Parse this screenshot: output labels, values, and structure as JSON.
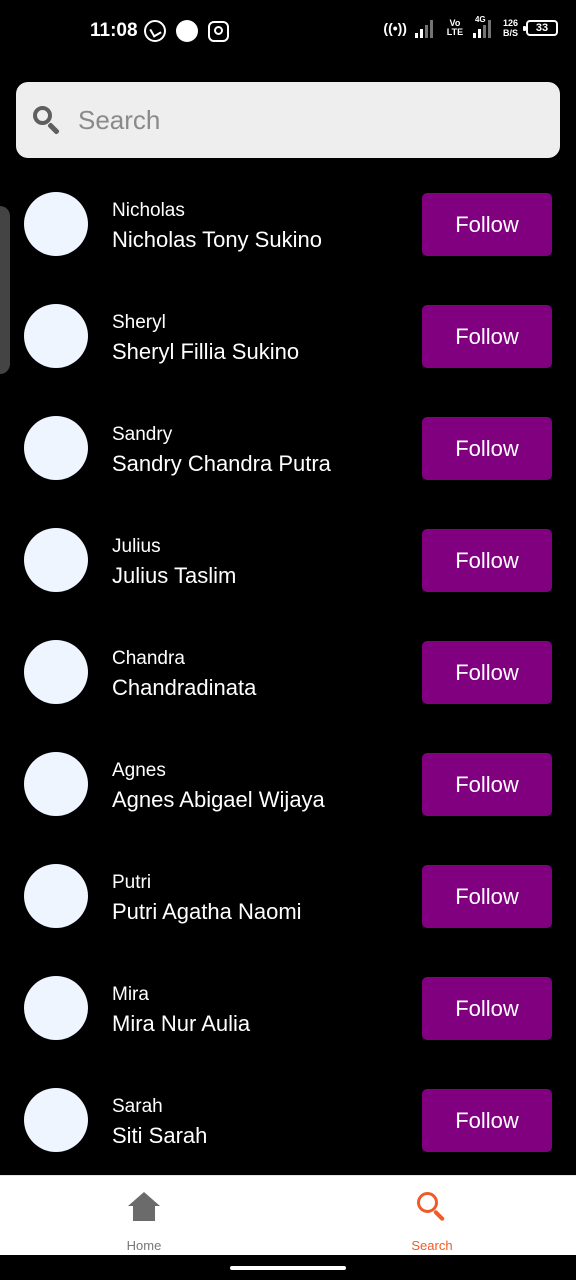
{
  "status_bar": {
    "time": "11:08",
    "hotspot": "((•))",
    "lte_top": "Vo",
    "lte_bottom": "LTE",
    "net_type": "4G",
    "speed_value": "126",
    "speed_unit": "B/S",
    "battery": "33"
  },
  "search": {
    "placeholder": "Search"
  },
  "users": [
    {
      "username": "Nicholas",
      "full_name": "Nicholas Tony Sukino",
      "button": "Follow"
    },
    {
      "username": "Sheryl",
      "full_name": "Sheryl Fillia Sukino",
      "button": "Follow"
    },
    {
      "username": "Sandry",
      "full_name": "Sandry Chandra Putra",
      "button": "Follow"
    },
    {
      "username": "Julius",
      "full_name": "Julius Taslim",
      "button": "Follow"
    },
    {
      "username": "Chandra",
      "full_name": "Chandradinata",
      "button": "Follow"
    },
    {
      "username": "Agnes",
      "full_name": "Agnes Abigael Wijaya",
      "button": "Follow"
    },
    {
      "username": "Putri",
      "full_name": "Putri Agatha Naomi",
      "button": "Follow"
    },
    {
      "username": "Mira",
      "full_name": "Mira Nur Aulia",
      "button": "Follow"
    },
    {
      "username": "Sarah",
      "full_name": "Siti Sarah",
      "button": "Follow"
    }
  ],
  "bottom_nav": {
    "home_label": "Home",
    "search_label": "Search",
    "active": "search"
  },
  "colors": {
    "follow_button": "#800080",
    "active_nav": "#f05a28",
    "avatar_placeholder": "#eef5ff"
  }
}
